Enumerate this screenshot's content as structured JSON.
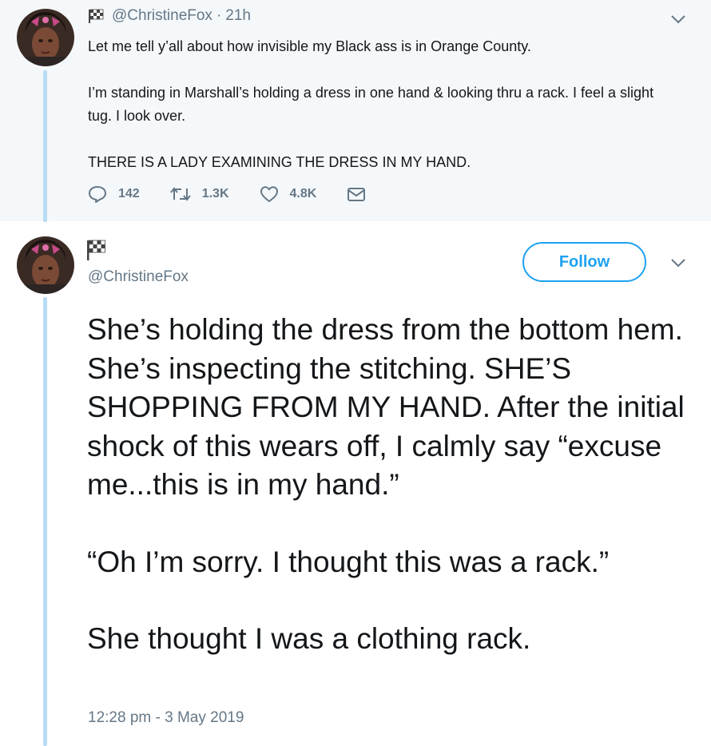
{
  "tweet1": {
    "handle": "@ChristineFox",
    "time_sep": "·",
    "time": "21h",
    "paragraphs": [
      "Let me tell y’all about how invisible my Black ass is in Orange County.",
      "I’m standing in Marshall’s holding a dress in one hand & looking thru a rack. I feel a slight tug. I look over.",
      "THERE IS A LADY EXAMINING THE DRESS IN MY HAND."
    ],
    "actions": {
      "replies": "142",
      "retweets": "1.3K",
      "likes": "4.8K"
    }
  },
  "tweet2": {
    "handle": "@ChristineFox",
    "follow_label": "Follow",
    "paragraphs": [
      "She’s holding the dress from the bottom hem. She’s inspecting the stitching. SHE’S SHOPPING FROM MY HAND. After the initial shock of this wears off, I calmly say “excuse me...this is in my hand.”",
      "“Oh I’m sorry. I thought this was a rack.”",
      "She thought I was a clothing rack."
    ],
    "timestamp": "12:28 pm - 3 May 2019"
  },
  "icons": {
    "display_name": "checkered-flag-icon",
    "reply": "speech-bubble-icon",
    "retweet": "retweet-arrows-icon",
    "like": "heart-icon",
    "dm": "envelope-icon",
    "menu": "chevron-down-icon"
  },
  "colors": {
    "accent": "#1da1f2",
    "thread_line": "#b8dcf5",
    "muted_text": "#657786",
    "highlight_bg": "#f5f8fa"
  }
}
